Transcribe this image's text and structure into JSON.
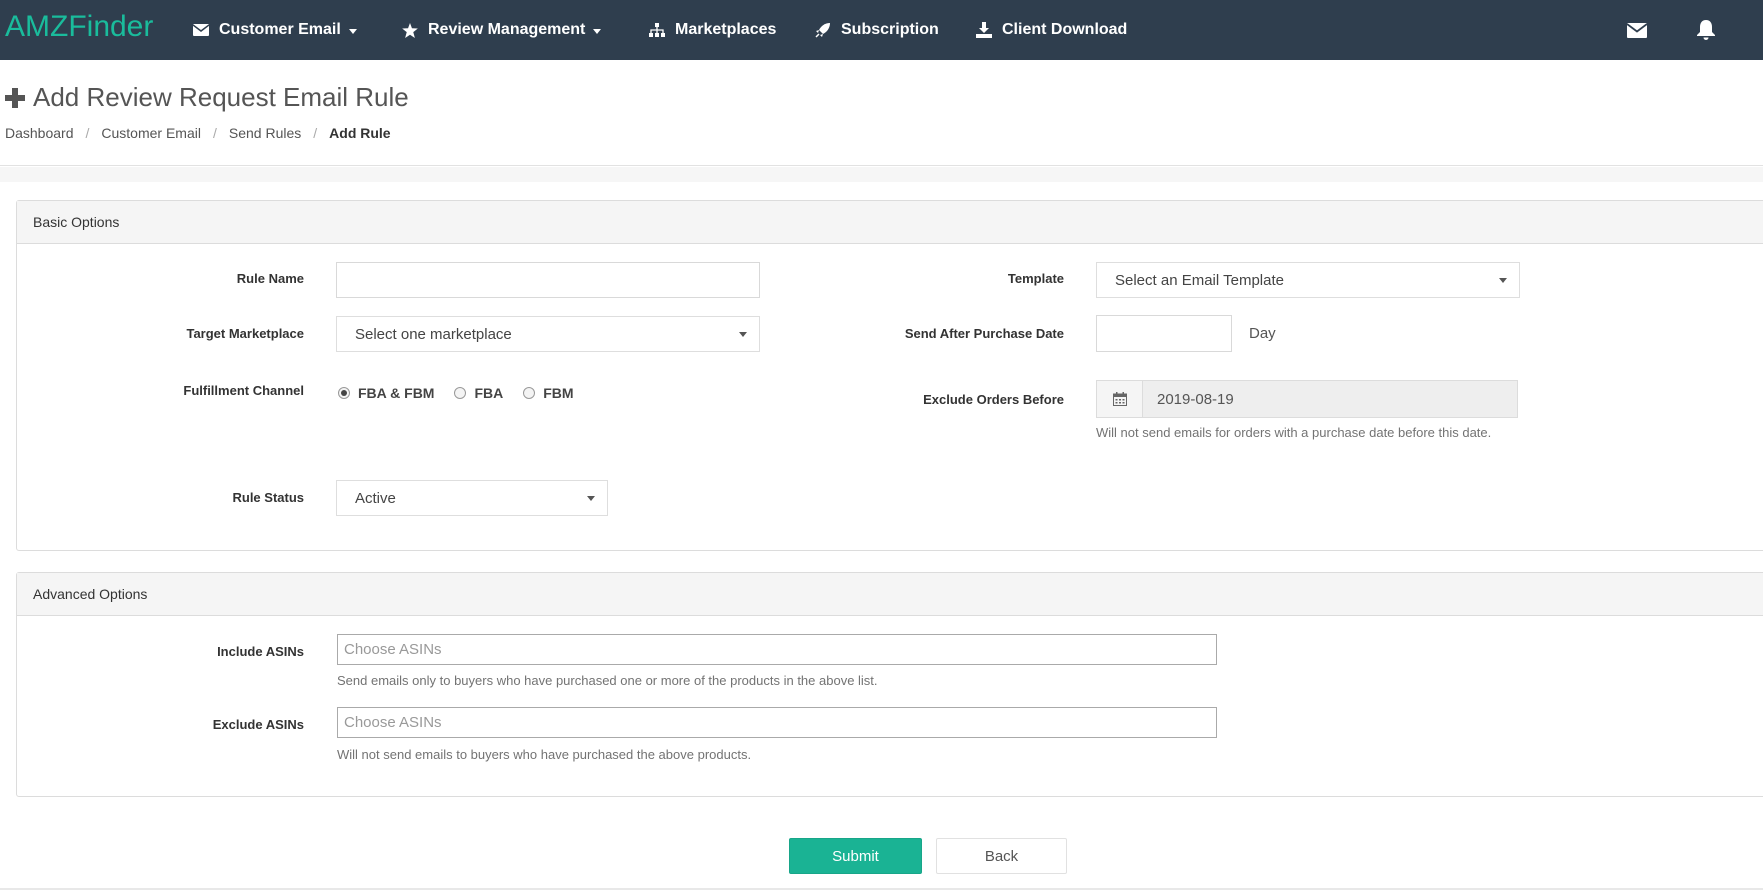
{
  "app": {
    "brand": "AMZFinder"
  },
  "nav": {
    "customer_email": "Customer Email",
    "review_management": "Review Management",
    "marketplaces": "Marketplaces",
    "subscription": "Subscription",
    "client_download": "Client Download",
    "icons": [
      "envelope-icon",
      "bell-icon"
    ]
  },
  "header": {
    "title": "Add Review Request Email Rule",
    "breadcrumb": [
      "Dashboard",
      "Customer Email",
      "Send Rules",
      "Add Rule"
    ]
  },
  "basic": {
    "heading": "Basic Options",
    "rule_name_label": "Rule Name",
    "rule_name_value": "",
    "target_marketplace_label": "Target Marketplace",
    "target_marketplace_value": "Select one marketplace",
    "fulfillment_label": "Fulfillment Channel",
    "fulfillment_options": [
      "FBA & FBM",
      "FBA",
      "FBM"
    ],
    "fulfillment_selected": "FBA & FBM",
    "rule_status_label": "Rule Status",
    "rule_status_value": "Active",
    "template_label": "Template",
    "template_value": "Select an Email Template",
    "send_after_label": "Send After Purchase Date",
    "send_after_value": "",
    "send_after_unit": "Day",
    "exclude_before_label": "Exclude Orders Before",
    "exclude_before_value": "2019-08-19",
    "exclude_before_help": "Will not send emails for orders with a purchase date before this date."
  },
  "advanced": {
    "heading": "Advanced Options",
    "include_label": "Include ASINs",
    "include_placeholder": "Choose ASINs",
    "include_help": "Send emails only to buyers who have purchased one or more of the products in the above list.",
    "exclude_label": "Exclude ASINs",
    "exclude_placeholder": "Choose ASINs",
    "exclude_help": "Will not send emails to buyers who have purchased the above products."
  },
  "actions": {
    "submit": "Submit",
    "back": "Back"
  },
  "colors": {
    "navbar": "#2f3e4e",
    "brand": "#1abc9c",
    "primary": "#1ab394"
  }
}
